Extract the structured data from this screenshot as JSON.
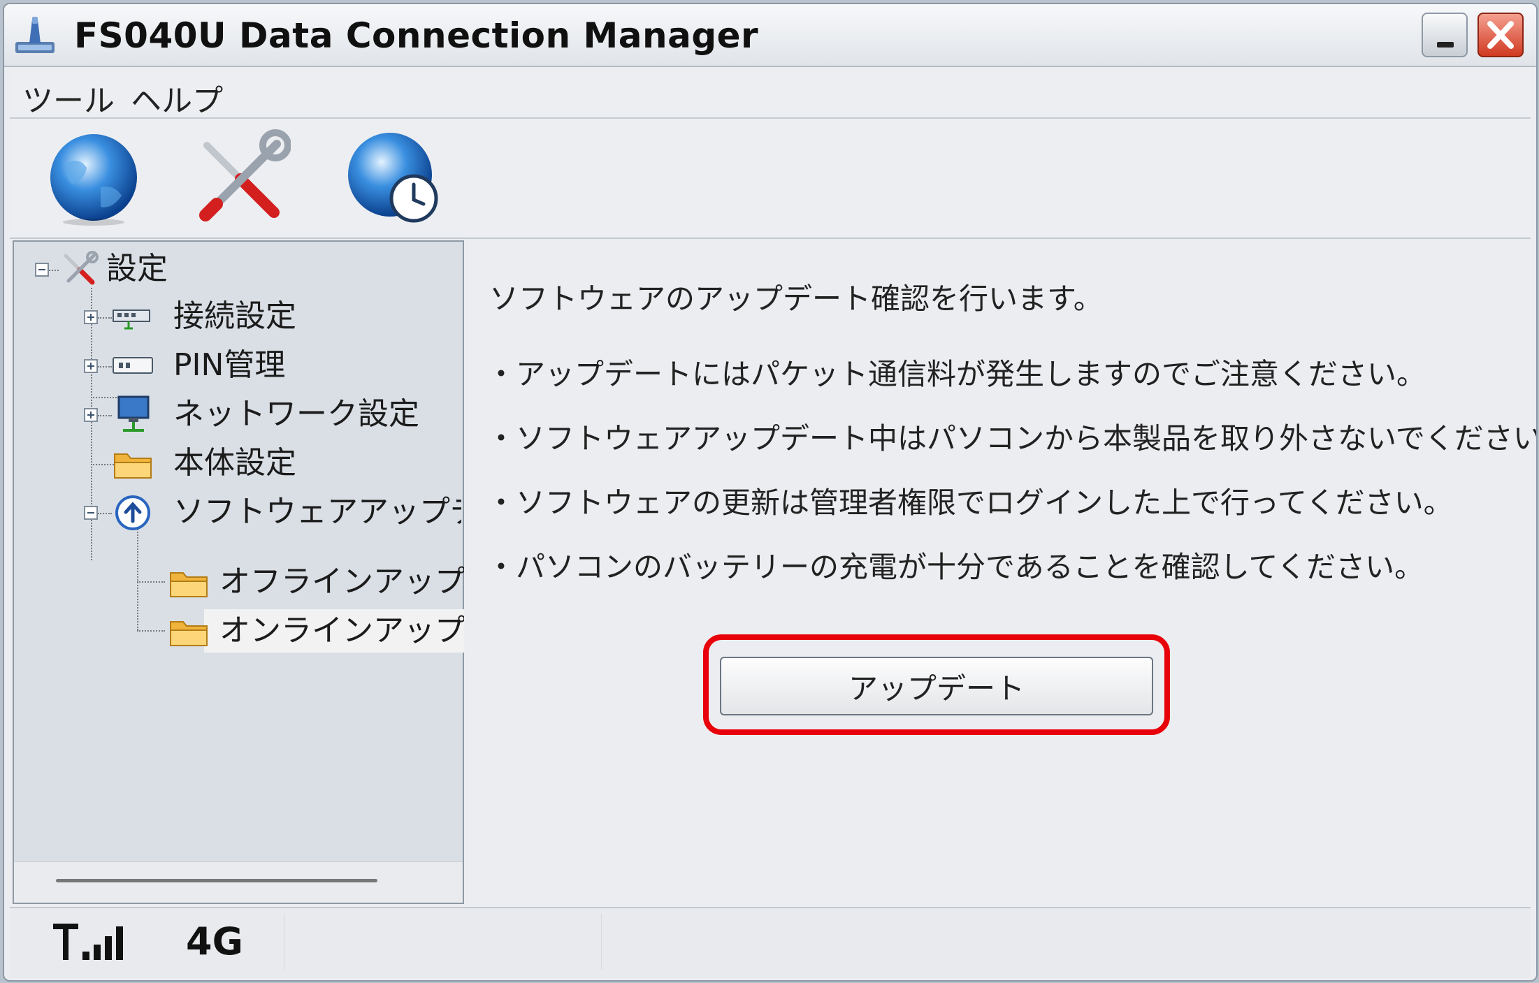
{
  "window": {
    "title": "FS040U Data Connection Manager",
    "accent_close": "#d03a22"
  },
  "menu": {
    "items": [
      "ツール",
      "ヘルプ"
    ]
  },
  "toolbar": {
    "buttons": [
      {
        "name": "connect-globe-icon"
      },
      {
        "name": "settings-tools-icon"
      },
      {
        "name": "schedule-globe-clock-icon"
      }
    ]
  },
  "tree": {
    "root": "設定",
    "nodes": [
      {
        "label": "接続設定",
        "icon": "network-adapter-icon",
        "expand": "plus"
      },
      {
        "label": "PIN管理",
        "icon": "sim-card-icon",
        "expand": "plus"
      },
      {
        "label": "ネットワーク設定",
        "icon": "computer-network-icon",
        "expand": "plus"
      },
      {
        "label": "本体設定",
        "icon": "folder-icon",
        "expand": "none"
      },
      {
        "label": "ソフトウェアアップデート設",
        "icon": "upload-arrow-icon",
        "expand": "minus"
      }
    ],
    "children": [
      {
        "label": "オフラインアップデート",
        "icon": "folder-icon"
      },
      {
        "label": "オンラインアップデート",
        "icon": "folder-icon",
        "selected": true
      }
    ]
  },
  "content": {
    "intro": "ソフトウェアのアップデート確認を行います。",
    "notes": [
      "アップデートにはパケット通信料が発生しますのでご注意ください。",
      "ソフトウェアアップデート中はパソコンから本製品を取り外さないでください。",
      "ソフトウェアの更新は管理者権限でログインした上で行ってください。",
      "パソコンのバッテリーの充電が十分であることを確認してください。"
    ],
    "update_button": "アップデート",
    "highlight_color": "#e8000a"
  },
  "status": {
    "network_type": "4G",
    "signal_bars": 4
  }
}
